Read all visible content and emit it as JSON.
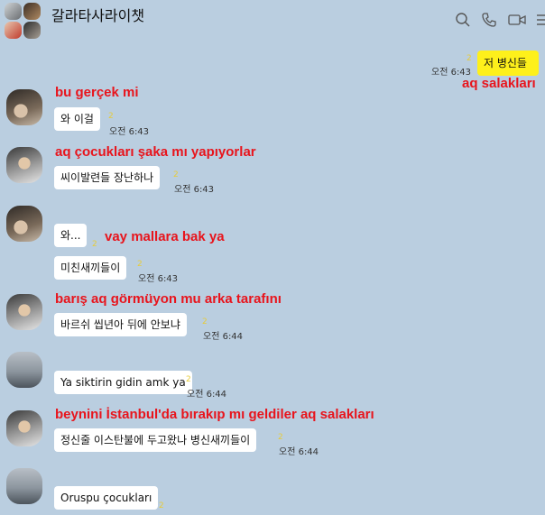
{
  "header": {
    "title": "갈라타사라이챗",
    "icons": [
      "search-icon",
      "call-icon",
      "video-icon",
      "menu-icon"
    ]
  },
  "messages": {
    "m1": {
      "text": "저 병신들",
      "count": "2",
      "time": "오전 6:43",
      "annotation": "aq salakları"
    },
    "m2": {
      "annotation": "bu gerçek mi",
      "text": "와 이걸",
      "count": "2",
      "time": "오전 6:43"
    },
    "m3": {
      "annotation": "aq çocukları şaka mı yapıyorlar",
      "text": "씨이발련들 장난하나",
      "count": "2",
      "time": "오전 6:43"
    },
    "m4": {
      "text": "와...",
      "count": "2",
      "annotation": "vay mallara bak ya"
    },
    "m5": {
      "text": "미친새끼들이",
      "count": "2",
      "time": "오전 6:43"
    },
    "m6": {
      "annotation": "barış aq görmüyon mu arka tarafını",
      "text": "바르쉬 씹년아 뒤에 안보냐",
      "count": "2",
      "time": "오전 6:44"
    },
    "m7": {
      "text": "Ya siktirin gidin amk ya",
      "count": "2",
      "time": "오전 6:44"
    },
    "m8": {
      "annotation": "beynini İstanbul'da bırakıp mı geldiler aq salakları",
      "text": "정신줄 이스탄불에 두고왔나 병신새끼들이",
      "count": "2",
      "time": "오전 6:44"
    },
    "m9": {
      "text": "Oruspu çocukları",
      "count": "2"
    }
  },
  "colors": {
    "background": "#bacee0",
    "my_bubble": "#fef01b",
    "other_bubble": "#ffffff",
    "annotation": "#e8141c"
  }
}
